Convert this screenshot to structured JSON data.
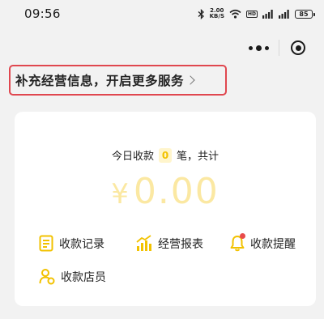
{
  "status_bar": {
    "time": "09:56",
    "net_speed_value": "2.00",
    "net_speed_unit": "KB/S",
    "hd_label": "HD",
    "battery": "85"
  },
  "icons": {
    "bluetooth": "bluetooth-icon",
    "wifi": "wifi-icon",
    "signal": "cellular-signal-icon",
    "battery": "battery-icon",
    "more": "more-dots-icon",
    "close": "close-miniprogram-icon",
    "chevron": "chevron-right-icon",
    "records": "document-icon",
    "report": "bar-chart-icon",
    "reminder": "bell-icon",
    "clerk": "staff-icon"
  },
  "banner": {
    "text": "补充经营信息，开启更多服务"
  },
  "summary": {
    "prefix": "今日收款",
    "count": "0",
    "suffix": "笔，共计",
    "currency": "¥",
    "amount": "0.00"
  },
  "menu": {
    "records": "收款记录",
    "report": "经营报表",
    "reminder": "收款提醒",
    "clerk": "收款店员"
  },
  "colors": {
    "accent": "#f2c200",
    "amount": "#fbe8a2",
    "highlight_border": "#e0474f",
    "notification_dot": "#e84b4b"
  }
}
